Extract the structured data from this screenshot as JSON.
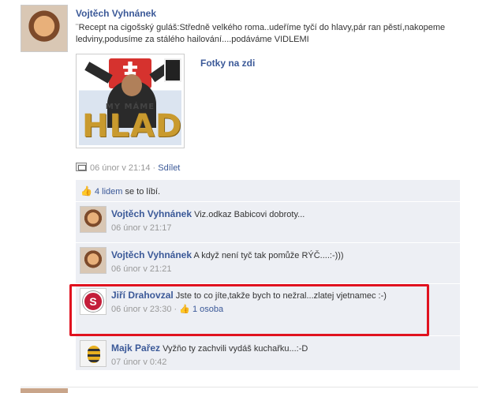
{
  "post": {
    "author": "Vojtěch Vyhnánek",
    "message": "¨Recept na cigošský guláš:Středně velkého roma..udeříme tyčí do hlavy,pár ran pěstí,nakopeme ledviny,podusíme za stálého hailování....podáváme VIDLEMI",
    "attachment": {
      "title": "Fotky na zdi",
      "photo_text_small": "MY MÁME",
      "photo_text_big": "HLAD"
    },
    "meta": {
      "time": "06 únor v 21:14",
      "separator": " · ",
      "share_label": "Sdílet"
    },
    "likes": {
      "count_link": "4 lidem",
      "suffix": " se to líbí."
    }
  },
  "comments": [
    {
      "author": "Vojtěch Vyhnánek",
      "text": " Viz.odkaz Babicovi dobroty...",
      "time": "06 únor v 21:17"
    },
    {
      "author": "Vojtěch Vyhnánek",
      "text": " A když není tyč tak pomůže RÝČ....:-)))",
      "time": "06 únor v 21:21"
    },
    {
      "author": "Jiří Drahovzal",
      "text": " Jste to co jíte,takže bych to nežral...zlatej vjetnamec :-)",
      "time": "06 únor v 23:30",
      "separator": " · ",
      "like_label": "1 osoba"
    },
    {
      "author": "Majk Pařez",
      "text": " Vyžňo ty zachvili vydáš kuchařku...:-D",
      "time": "07 únor v 0:42"
    }
  ],
  "colors": {
    "link": "#3b5998",
    "feedback_bg": "#edeff4",
    "highlight": "#e0121f"
  },
  "icons": {
    "like": "thumbs-up-icon",
    "meta": "photo-stream-icon"
  }
}
